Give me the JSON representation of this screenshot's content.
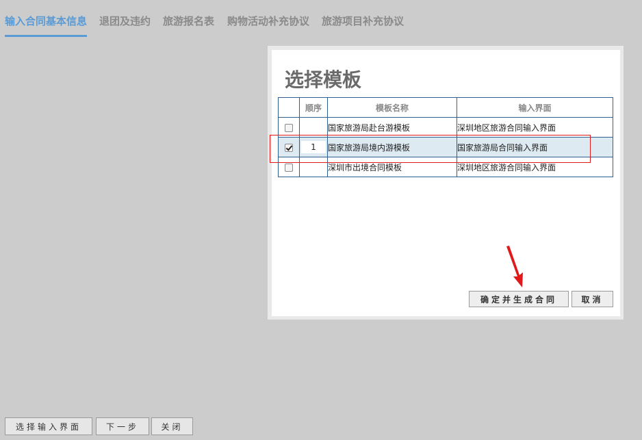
{
  "tabs": [
    {
      "label": "输入合同基本信息",
      "active": true
    },
    {
      "label": "退团及违约",
      "active": false
    },
    {
      "label": "旅游报名表",
      "active": false
    },
    {
      "label": "购物活动补充协议",
      "active": false
    },
    {
      "label": "旅游项目补充协议",
      "active": false
    }
  ],
  "dialog": {
    "title": "选择模板",
    "columns": {
      "check": "",
      "order": "顺序",
      "name": "模板名称",
      "input_ui": "输入界面"
    },
    "rows": [
      {
        "checked": false,
        "order": "",
        "name": "国家旅游局赴台游模板",
        "input_ui": "深圳地区旅游合同输入界面"
      },
      {
        "checked": true,
        "order": "1",
        "name": "国家旅游局境内游模板",
        "input_ui": "国家旅游局合同输入界面"
      },
      {
        "checked": false,
        "order": "",
        "name": "深圳市出境合同模板",
        "input_ui": "深圳地区旅游合同输入界面"
      }
    ],
    "confirm_label": "确定并生成合同",
    "cancel_label": "取消"
  },
  "footer": {
    "select_ui_label": "选择输入界面",
    "next_label": "下一步",
    "close_label": "关闭"
  },
  "colors": {
    "accent": "#5b9bd5",
    "highlight_box": "#e0191b",
    "selected_row": "#deeaf1",
    "table_border": "#2f5f8f"
  }
}
